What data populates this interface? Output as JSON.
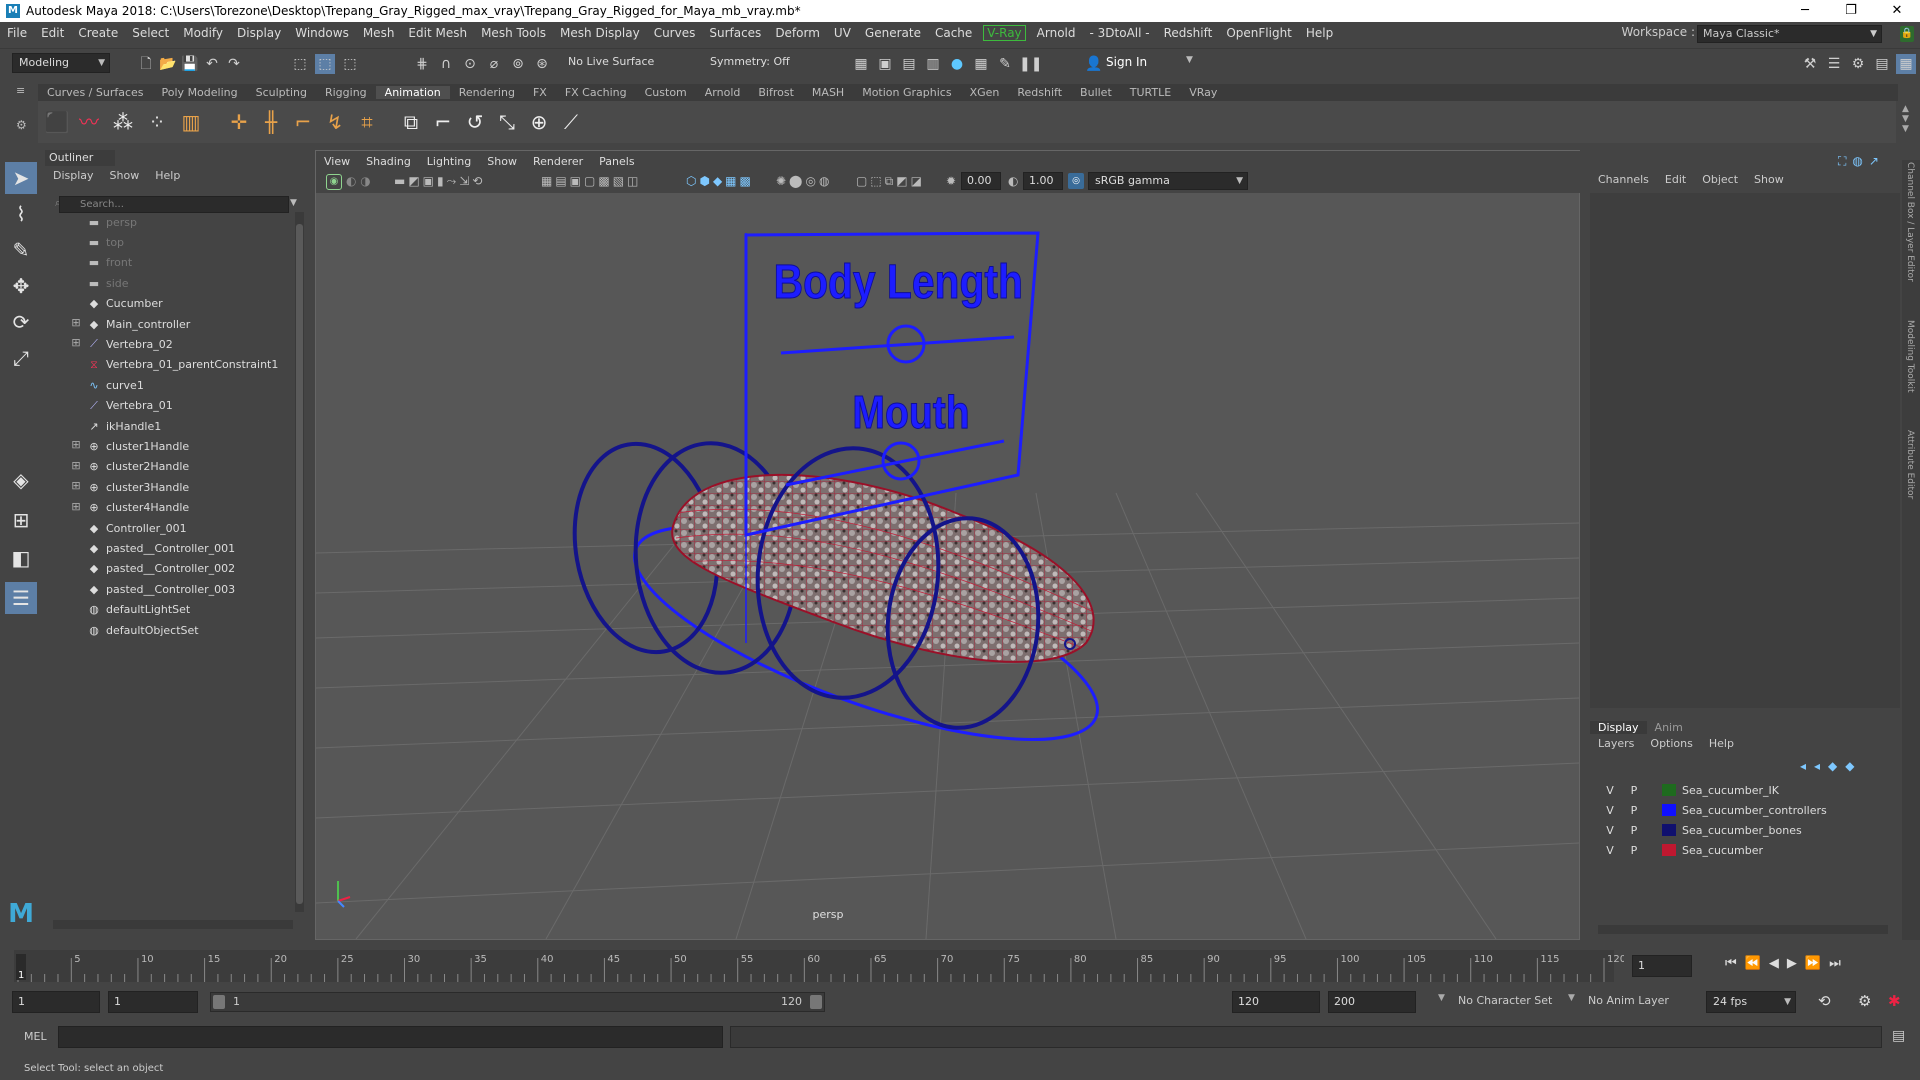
{
  "window": {
    "title": "Autodesk Maya 2018: C:\\Users\\Torezone\\Desktop\\Trepang_Gray_Rigged_max_vray\\Trepang_Gray_Rigged_for_Maya_mb_vray.mb*",
    "app_icon": "M",
    "min": "─",
    "max": "❐",
    "close": "✕"
  },
  "menubar": {
    "items": [
      "File",
      "Edit",
      "Create",
      "Select",
      "Modify",
      "Display",
      "Windows",
      "Mesh",
      "Edit Mesh",
      "Mesh Tools",
      "Mesh Display",
      "Curves",
      "Surfaces",
      "Deform",
      "UV",
      "Generate",
      "Cache"
    ],
    "vray": "V-Ray",
    "items2": [
      "Arnold",
      "- 3DtoAll -",
      "Redshift",
      "OpenFlight",
      "Help"
    ]
  },
  "workspace": {
    "label": "Workspace :",
    "value": "Maya Classic*"
  },
  "statusline": {
    "mode": "Modeling",
    "live_surface": "No Live Surface",
    "symmetry": "Symmetry: Off",
    "sign_in": "Sign In"
  },
  "shelf": {
    "tabs": [
      "Curves / Surfaces",
      "Poly Modeling",
      "Sculpting",
      "Rigging",
      "Animation",
      "Rendering",
      "FX",
      "FX Caching",
      "Custom",
      "Arnold",
      "Bifrost",
      "MASH",
      "Motion Graphics",
      "XGen",
      "Redshift",
      "Bullet",
      "TURTLE",
      "VRay"
    ],
    "active": "Animation"
  },
  "outliner": {
    "title": "Outliner",
    "menu": [
      "Display",
      "Show",
      "Help"
    ],
    "search_placeholder": "Search...",
    "items": [
      {
        "label": "persp",
        "icon": "camera-icon",
        "expand": "",
        "dim": true
      },
      {
        "label": "top",
        "icon": "camera-icon",
        "expand": "",
        "dim": true
      },
      {
        "label": "front",
        "icon": "camera-icon",
        "expand": "",
        "dim": true
      },
      {
        "label": "side",
        "icon": "camera-icon",
        "expand": "",
        "dim": true
      },
      {
        "label": "Cucumber",
        "icon": "transform-icon",
        "expand": "",
        "dim": false
      },
      {
        "label": "Main_controller",
        "icon": "transform-icon",
        "expand": "⊞",
        "dim": false
      },
      {
        "label": "Vertebra_02",
        "icon": "joint-icon",
        "expand": "⊞",
        "dim": false
      },
      {
        "label": "Vertebra_01_parentConstraint1",
        "icon": "constraint-icon",
        "expand": "",
        "dim": false
      },
      {
        "label": "curve1",
        "icon": "curve-icon",
        "expand": "",
        "dim": false
      },
      {
        "label": "Vertebra_01",
        "icon": "joint-icon",
        "expand": "",
        "dim": false
      },
      {
        "label": "ikHandle1",
        "icon": "ik-handle-icon",
        "expand": "",
        "dim": false
      },
      {
        "label": "cluster1Handle",
        "icon": "cluster-icon",
        "expand": "⊞",
        "dim": false
      },
      {
        "label": "cluster2Handle",
        "icon": "cluster-icon",
        "expand": "⊞",
        "dim": false
      },
      {
        "label": "cluster3Handle",
        "icon": "cluster-icon",
        "expand": "⊞",
        "dim": false
      },
      {
        "label": "cluster4Handle",
        "icon": "cluster-icon",
        "expand": "⊞",
        "dim": false
      },
      {
        "label": "Controller_001",
        "icon": "transform-icon",
        "expand": "",
        "dim": false
      },
      {
        "label": "pasted__Controller_001",
        "icon": "transform-icon",
        "expand": "",
        "dim": false
      },
      {
        "label": "pasted__Controller_002",
        "icon": "transform-icon",
        "expand": "",
        "dim": false
      },
      {
        "label": "pasted__Controller_003",
        "icon": "transform-icon",
        "expand": "",
        "dim": false
      },
      {
        "label": "defaultLightSet",
        "icon": "set-icon",
        "expand": "",
        "dim": false
      },
      {
        "label": "defaultObjectSet",
        "icon": "set-icon",
        "expand": "",
        "dim": false
      }
    ]
  },
  "viewport": {
    "menu": [
      "View",
      "Shading",
      "Lighting",
      "Show",
      "Renderer",
      "Panels"
    ],
    "exposure": "0.00",
    "gamma": "1.00",
    "color_space": "sRGB gamma",
    "camera_label": "persp",
    "panel_text_1": "Body Length",
    "panel_text_2": "Mouth"
  },
  "channelbox": {
    "menu": [
      "Channels",
      "Edit",
      "Object",
      "Show"
    ]
  },
  "layers": {
    "tabs": [
      "Display",
      "Anim"
    ],
    "menu": [
      "Layers",
      "Options",
      "Help"
    ],
    "rows": [
      {
        "v": "V",
        "p": "P",
        "color": "#1e6b1e",
        "name": "Sea_cucumber_IK"
      },
      {
        "v": "V",
        "p": "P",
        "color": "#1010ff",
        "name": "Sea_cucumber_controllers"
      },
      {
        "v": "V",
        "p": "P",
        "color": "#10106e",
        "name": "Sea_cucumber_bones"
      },
      {
        "v": "V",
        "p": "P",
        "color": "#c01830",
        "name": "Sea_cucumber"
      }
    ]
  },
  "timeline": {
    "ticks": [
      "5",
      "10",
      "15",
      "20",
      "25",
      "30",
      "35",
      "40",
      "45",
      "50",
      "55",
      "60",
      "65",
      "70",
      "75",
      "80",
      "85",
      "90",
      "95",
      "100",
      "105",
      "110",
      "115",
      "120"
    ],
    "current_frame": "1",
    "start_marker": "1"
  },
  "range": {
    "start": "1",
    "playback_start": "1",
    "range_start": "1",
    "range_end": "120",
    "playback_end": "120",
    "end": "200",
    "character_set": "No Character Set",
    "anim_layer": "No Anim Layer",
    "fps": "24 fps"
  },
  "mel": {
    "label": "MEL"
  },
  "helpline": {
    "text": "Select Tool: select an object"
  },
  "sidetabs": [
    "Channel Box / Layer Editor",
    "Modeling Toolkit",
    "Attribute Editor"
  ]
}
